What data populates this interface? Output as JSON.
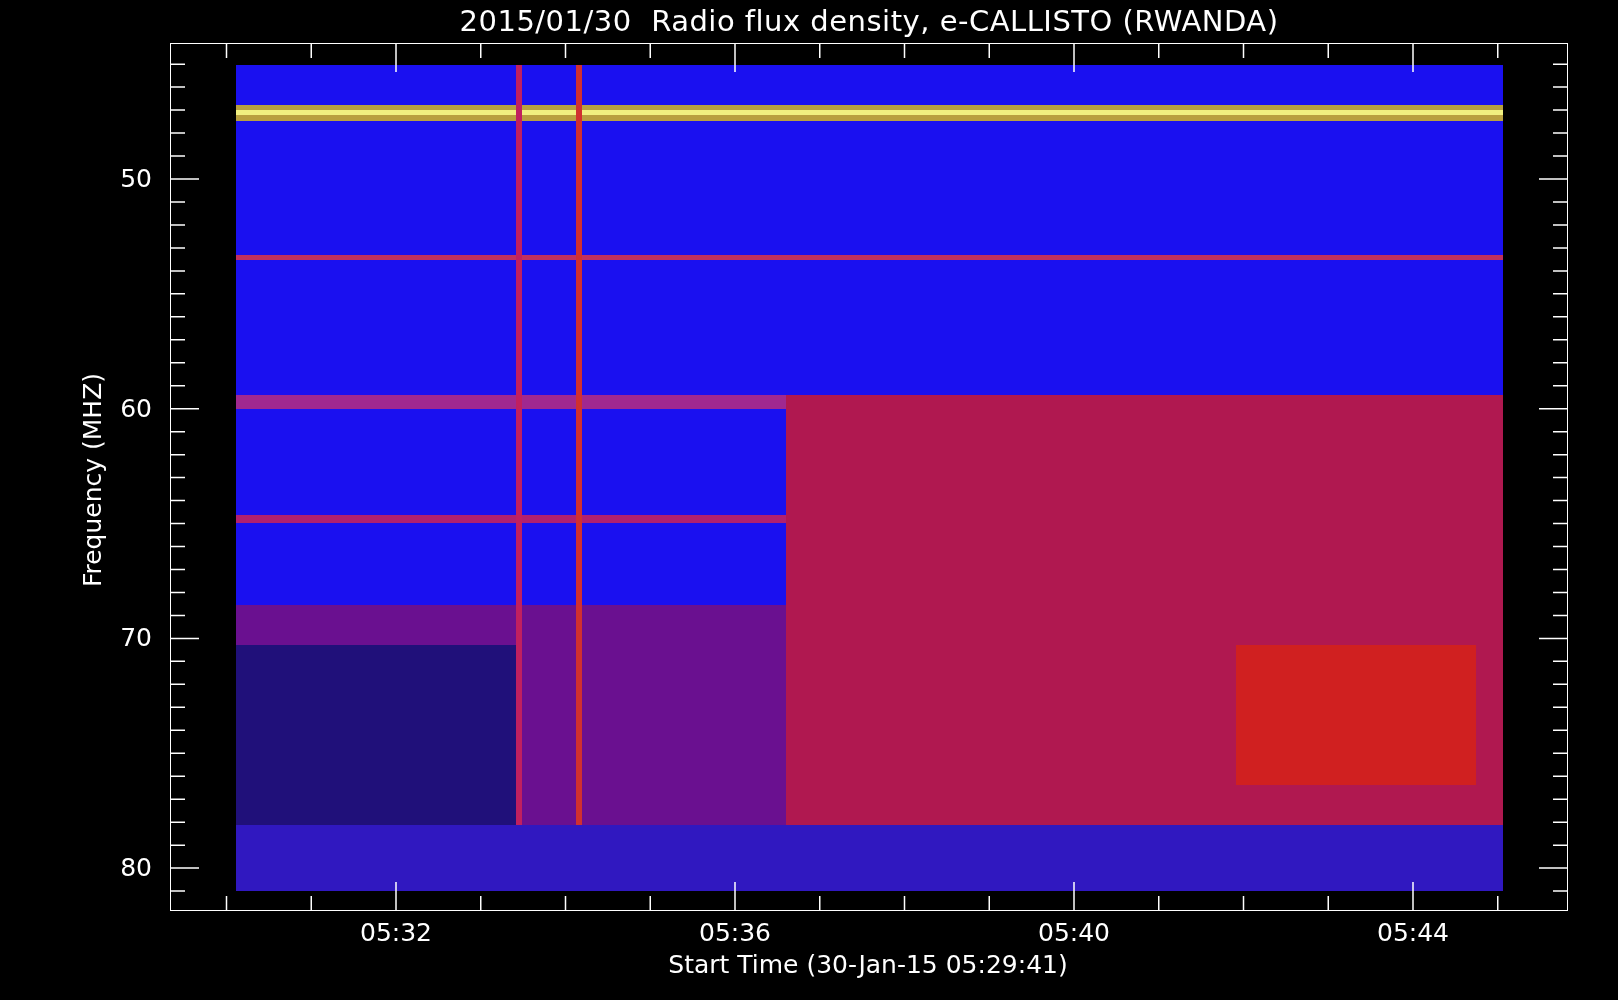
{
  "title": "2015/01/30  Radio flux density, e-CALLISTO (RWANDA)",
  "y_axis": {
    "label": "Frequency (MHZ)",
    "ticks": [
      "50",
      "60",
      "70",
      "80"
    ]
  },
  "x_axis": {
    "label": "Start Time (30-Jan-15 05:29:41)",
    "ticks": [
      "05:32",
      "05:36",
      "05:40",
      "05:44"
    ]
  }
}
